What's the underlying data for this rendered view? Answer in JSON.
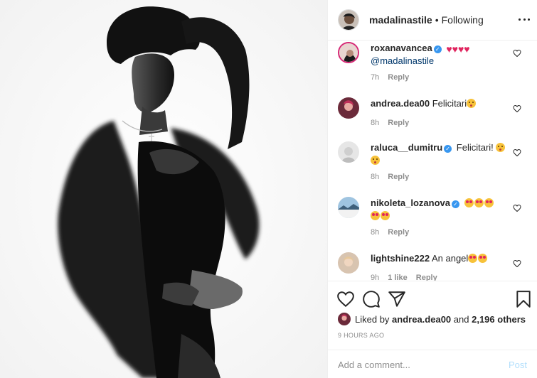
{
  "header": {
    "username": "madalinastile",
    "separator": "•",
    "follow_status": "Following"
  },
  "comments": [
    {
      "username": "roxanavancea",
      "verified": true,
      "text": "",
      "emoji": "heart-emoji x4",
      "mention": "@madalinastile",
      "time": "7h",
      "likes": "",
      "reply": "Reply"
    },
    {
      "username": "andrea.dea00",
      "verified": false,
      "text": "Felicitari",
      "emoji": "kiss-emoji",
      "time": "8h",
      "likes": "",
      "reply": "Reply"
    },
    {
      "username": "raluca__dumitru",
      "verified": true,
      "text": "Felicitari!",
      "emoji": "kiss-emoji x2",
      "time": "8h",
      "likes": "",
      "reply": "Reply"
    },
    {
      "username": "nikoleta_lozanova",
      "verified": true,
      "text": "",
      "emoji": "heart-eyes-emoji x5",
      "time": "8h",
      "likes": "",
      "reply": "Reply"
    },
    {
      "username": "lightshine222",
      "verified": false,
      "text": "An angel",
      "emoji": "heart-eyes-emoji x2",
      "time": "9h",
      "likes": "1 like",
      "reply": "Reply"
    }
  ],
  "actions": {
    "like_icon": "heart-outline-icon",
    "comment_icon": "comment-bubble-icon",
    "share_icon": "paper-plane-icon",
    "save_icon": "bookmark-icon"
  },
  "likes": {
    "prefix": "Liked by",
    "user": "andrea.dea00",
    "conjunction": "and",
    "others": "2,196 others"
  },
  "timestamp": "9 HOURS AGO",
  "add_comment": {
    "placeholder": "Add a comment...",
    "post_label": "Post"
  },
  "colors": {
    "link": "#00376b",
    "verified": "#3897f0",
    "muted": "#8e8e8e",
    "post_disabled": "#b2dffc",
    "border": "#efefef"
  }
}
